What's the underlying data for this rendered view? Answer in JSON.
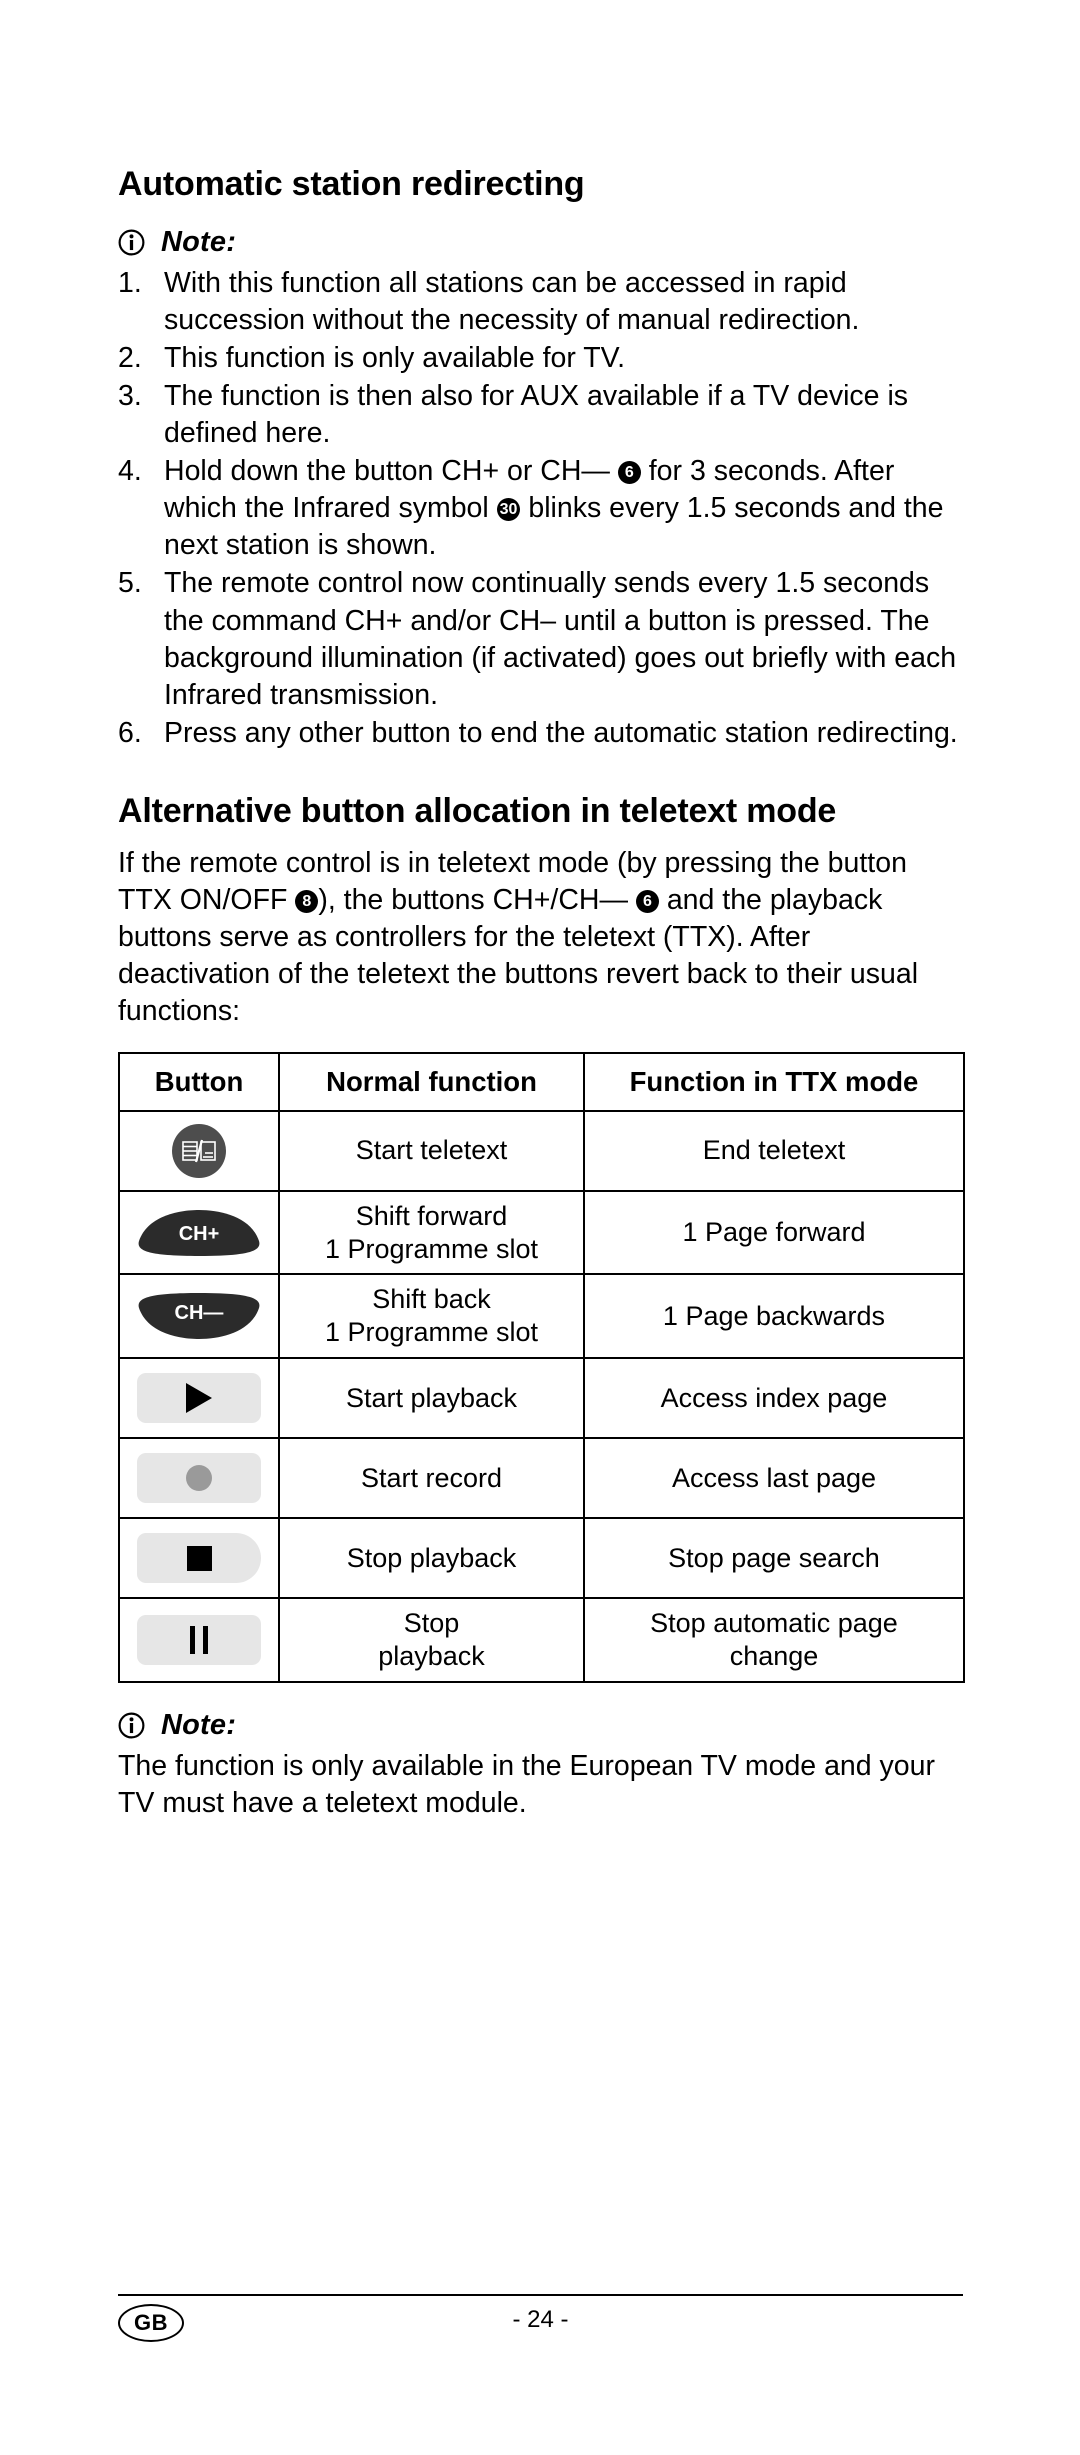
{
  "document": {
    "section1": {
      "title": "Automatic station redirecting",
      "note_label": "Note:",
      "steps": [
        {
          "num": "1.",
          "text_before": "With this function all stations can be accessed in rapid succession without the necessity of manual redirection."
        },
        {
          "num": "2.",
          "text_before": "This function is only available for TV."
        },
        {
          "num": "3.",
          "text_before": "The function is then also for AUX available if a TV device is defined here."
        },
        {
          "num": "4.",
          "text_before": "Hold down the button CH+ or CH— ",
          "badge1": "6",
          "text_mid": " for 3 seconds. After which the Infrared symbol ",
          "badge2": "30",
          "text_after": " blinks every 1.5 seconds and the next station is shown."
        },
        {
          "num": "5.",
          "text_before": "The remote control now continually sends every 1.5 seconds the command CH+ and/or CH– until a button is pressed. The background illumination (if activated) goes out briefly with each Infrared transmission."
        },
        {
          "num": "6.",
          "text_before": "Press any other button to end the automatic station redirecting."
        }
      ]
    },
    "section2": {
      "title": "Alternative button allocation in teletext mode",
      "para_before": "If the remote control is in teletext mode (by pressing the button TTX ON/OFF ",
      "badge1": "8",
      "para_mid": "), the buttons CH+/CH— ",
      "badge2": "6",
      "para_after": " and the playback buttons serve as controllers for the teletext (TTX). After deactivation of the teletext the buttons revert back to their usual functions:"
    },
    "table": {
      "headers": [
        "Button",
        "Normal function",
        "Function in TTX mode"
      ],
      "rows": [
        {
          "icon": "teletext-icon",
          "icon_label": "",
          "normal": "Start teletext",
          "ttx": "End teletext"
        },
        {
          "icon": "ch-plus-rocker",
          "icon_label": "CH+",
          "normal": "Shift forward\n1 Programme slot",
          "ttx": "1 Page forward"
        },
        {
          "icon": "ch-minus-rocker",
          "icon_label": "CH—",
          "normal": "Shift back\n1 Programme slot",
          "ttx": "1 Page backwards"
        },
        {
          "icon": "play-icon",
          "icon_label": "",
          "normal": "Start playback",
          "ttx": "Access index page"
        },
        {
          "icon": "record-icon",
          "icon_label": "",
          "normal": "Start record",
          "ttx": "Access last page"
        },
        {
          "icon": "stop-icon",
          "icon_label": "",
          "normal": "Stop playback",
          "ttx": "Stop page search"
        },
        {
          "icon": "pause-icon",
          "icon_label": "",
          "normal": "Stop\nplayback",
          "ttx": "Stop automatic page\nchange"
        }
      ]
    },
    "section3": {
      "note_label": "Note:",
      "text": "The function is only available in the European TV mode and your TV must have a teletext module."
    },
    "footer": {
      "language_code": "GB",
      "page_number": "- 24 -"
    }
  }
}
